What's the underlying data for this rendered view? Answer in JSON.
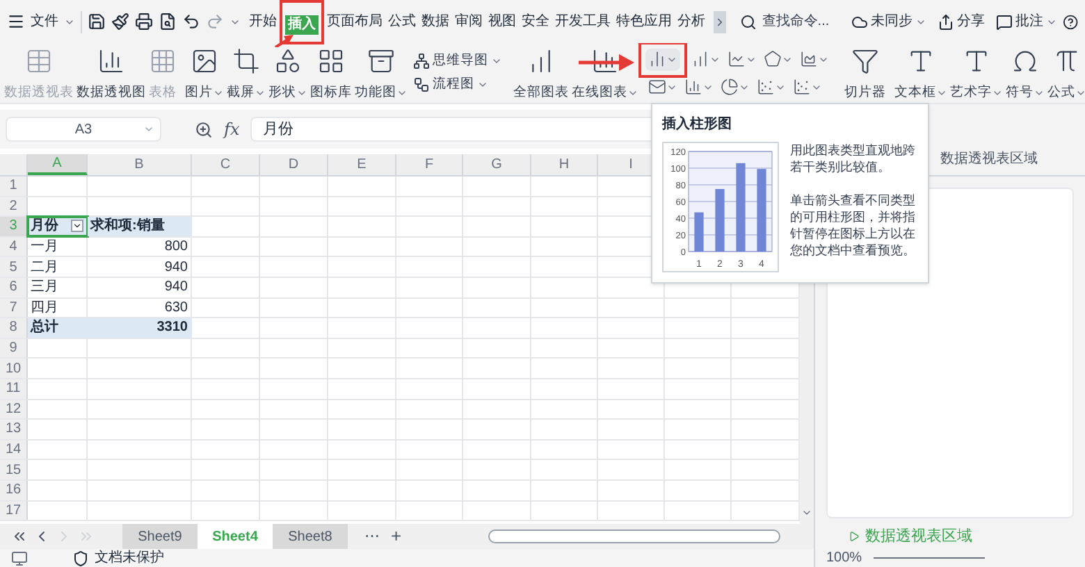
{
  "menu_bar": {
    "file": "文件",
    "tabs": [
      {
        "label": "开始",
        "selected": false
      },
      {
        "label": "插入",
        "selected": true
      },
      {
        "label": "页面布局",
        "selected": false
      },
      {
        "label": "公式",
        "selected": false
      },
      {
        "label": "数据",
        "selected": false
      },
      {
        "label": "审阅",
        "selected": false
      },
      {
        "label": "视图",
        "selected": false
      },
      {
        "label": "安全",
        "selected": false
      },
      {
        "label": "开发工具",
        "selected": false
      },
      {
        "label": "特色应用",
        "selected": false
      },
      {
        "label": "分析",
        "selected": false
      }
    ],
    "search": {
      "placeholder": "查找命令..."
    },
    "actions": [
      {
        "label": "未同步",
        "dropdown": true
      },
      {
        "label": "分享",
        "dropdown": false
      },
      {
        "label": "批注",
        "dropdown": true
      }
    ]
  },
  "ribbon": [
    {
      "kind": "big",
      "label": "数据透视表",
      "disabled": true,
      "dropdown": false
    },
    {
      "kind": "big",
      "label": "数据透视图",
      "disabled": false,
      "dropdown": false
    },
    {
      "kind": "big",
      "label": "表格",
      "disabled": true,
      "dropdown": false
    },
    {
      "kind": "big",
      "label": "图片",
      "disabled": false,
      "dropdown": true
    },
    {
      "kind": "big",
      "label": "截屏",
      "disabled": false,
      "dropdown": true
    },
    {
      "kind": "big",
      "label": "形状",
      "disabled": false,
      "dropdown": true
    },
    {
      "kind": "big",
      "label": "图标库",
      "disabled": false,
      "dropdown": false
    },
    {
      "kind": "big",
      "label": "功能图",
      "disabled": false,
      "dropdown": true
    },
    {
      "kind": "stack",
      "items": [
        {
          "label": "思维导图",
          "dropdown": true
        },
        {
          "label": "流程图",
          "dropdown": true
        }
      ]
    },
    {
      "kind": "big",
      "label": "全部图表",
      "disabled": false,
      "dropdown": false
    },
    {
      "kind": "big",
      "label": "在线图表",
      "disabled": false,
      "dropdown": true
    },
    {
      "kind": "charts"
    },
    {
      "kind": "big",
      "label": "切片器",
      "disabled": false,
      "dropdown": false
    },
    {
      "kind": "big",
      "label": "文本框",
      "disabled": false,
      "dropdown": true
    },
    {
      "kind": "big",
      "label": "艺术字",
      "disabled": false,
      "dropdown": true
    },
    {
      "kind": "big",
      "label": "符号",
      "disabled": false,
      "dropdown": true
    },
    {
      "kind": "big",
      "label": "公式",
      "disabled": false,
      "dropdown": true
    }
  ],
  "formula_bar": {
    "name_box": "A3",
    "fx": "fx",
    "value": "月份"
  },
  "sheet": {
    "columns": [
      {
        "label": "A",
        "selected": true
      },
      {
        "label": "B",
        "selected": false
      },
      {
        "label": "C",
        "selected": false
      },
      {
        "label": "D",
        "selected": false
      },
      {
        "label": "E",
        "selected": false
      },
      {
        "label": "F",
        "selected": false
      },
      {
        "label": "G",
        "selected": false
      },
      {
        "label": "H",
        "selected": false
      },
      {
        "label": "I",
        "selected": false
      }
    ],
    "rows": [
      {
        "number": "1",
        "selected": false,
        "kind": "blank",
        "cells": []
      },
      {
        "number": "2",
        "selected": false,
        "kind": "blank",
        "cells": []
      },
      {
        "number": "3",
        "selected": true,
        "kind": "header",
        "cells": [
          {
            "text": "月份",
            "selected": true,
            "filter": true
          },
          {
            "text": "求和项:销量",
            "selected": false,
            "filter": false
          }
        ]
      },
      {
        "number": "4",
        "selected": false,
        "kind": "item",
        "cells": [
          {
            "text": "一月",
            "selected": false,
            "filter": false
          },
          {
            "text": "800",
            "selected": false,
            "filter": false
          }
        ]
      },
      {
        "number": "5",
        "selected": false,
        "kind": "item",
        "cells": [
          {
            "text": "二月",
            "selected": false,
            "filter": false
          },
          {
            "text": "940",
            "selected": false,
            "filter": false
          }
        ]
      },
      {
        "number": "6",
        "selected": false,
        "kind": "item",
        "cells": [
          {
            "text": "三月",
            "selected": false,
            "filter": false
          },
          {
            "text": "940",
            "selected": false,
            "filter": false
          }
        ]
      },
      {
        "number": "7",
        "selected": false,
        "kind": "item",
        "cells": [
          {
            "text": "四月",
            "selected": false,
            "filter": false
          },
          {
            "text": "630",
            "selected": false,
            "filter": false
          }
        ]
      },
      {
        "number": "8",
        "selected": false,
        "kind": "total",
        "cells": [
          {
            "text": "总计",
            "selected": false,
            "filter": false
          },
          {
            "text": "3310",
            "selected": false,
            "filter": false
          }
        ]
      },
      {
        "number": "9",
        "selected": false,
        "kind": "blank",
        "cells": []
      },
      {
        "number": "10",
        "selected": false,
        "kind": "blank",
        "cells": []
      },
      {
        "number": "11",
        "selected": false,
        "kind": "blank",
        "cells": []
      },
      {
        "number": "12",
        "selected": false,
        "kind": "blank",
        "cells": []
      },
      {
        "number": "13",
        "selected": false,
        "kind": "blank",
        "cells": []
      },
      {
        "number": "14",
        "selected": false,
        "kind": "blank",
        "cells": []
      },
      {
        "number": "15",
        "selected": false,
        "kind": "blank",
        "cells": []
      },
      {
        "number": "16",
        "selected": false,
        "kind": "blank",
        "cells": []
      },
      {
        "number": "17",
        "selected": false,
        "kind": "blank",
        "cells": []
      }
    ]
  },
  "tooltip": {
    "title": "插入柱形图",
    "paragraphs": [
      "用此图表类型直观地跨若干类别比较值。",
      "单击箭头查看不同类型的可用柱形图，并将指针暂停在图标上方以在您的文档中查看预览。"
    ],
    "chart_data": {
      "type": "bar",
      "categories": [
        "1",
        "2",
        "3",
        "4"
      ],
      "values": [
        47,
        75,
        106,
        99
      ],
      "ylim": [
        0,
        120
      ],
      "yticks": [
        0,
        20,
        40,
        60,
        80,
        100,
        120
      ],
      "grid": true
    }
  },
  "pivot_panel": {
    "top_label": "数据透视表区域",
    "section": "数据透视表区域"
  },
  "sheet_tabs": {
    "tabs": [
      {
        "label": "Sheet9",
        "selected": false
      },
      {
        "label": "Sheet4",
        "selected": true
      },
      {
        "label": "Sheet8",
        "selected": false
      }
    ],
    "more": "⋯",
    "add": "+"
  },
  "status_bar": {
    "protection": "文档未保护",
    "zoom": "100%"
  }
}
